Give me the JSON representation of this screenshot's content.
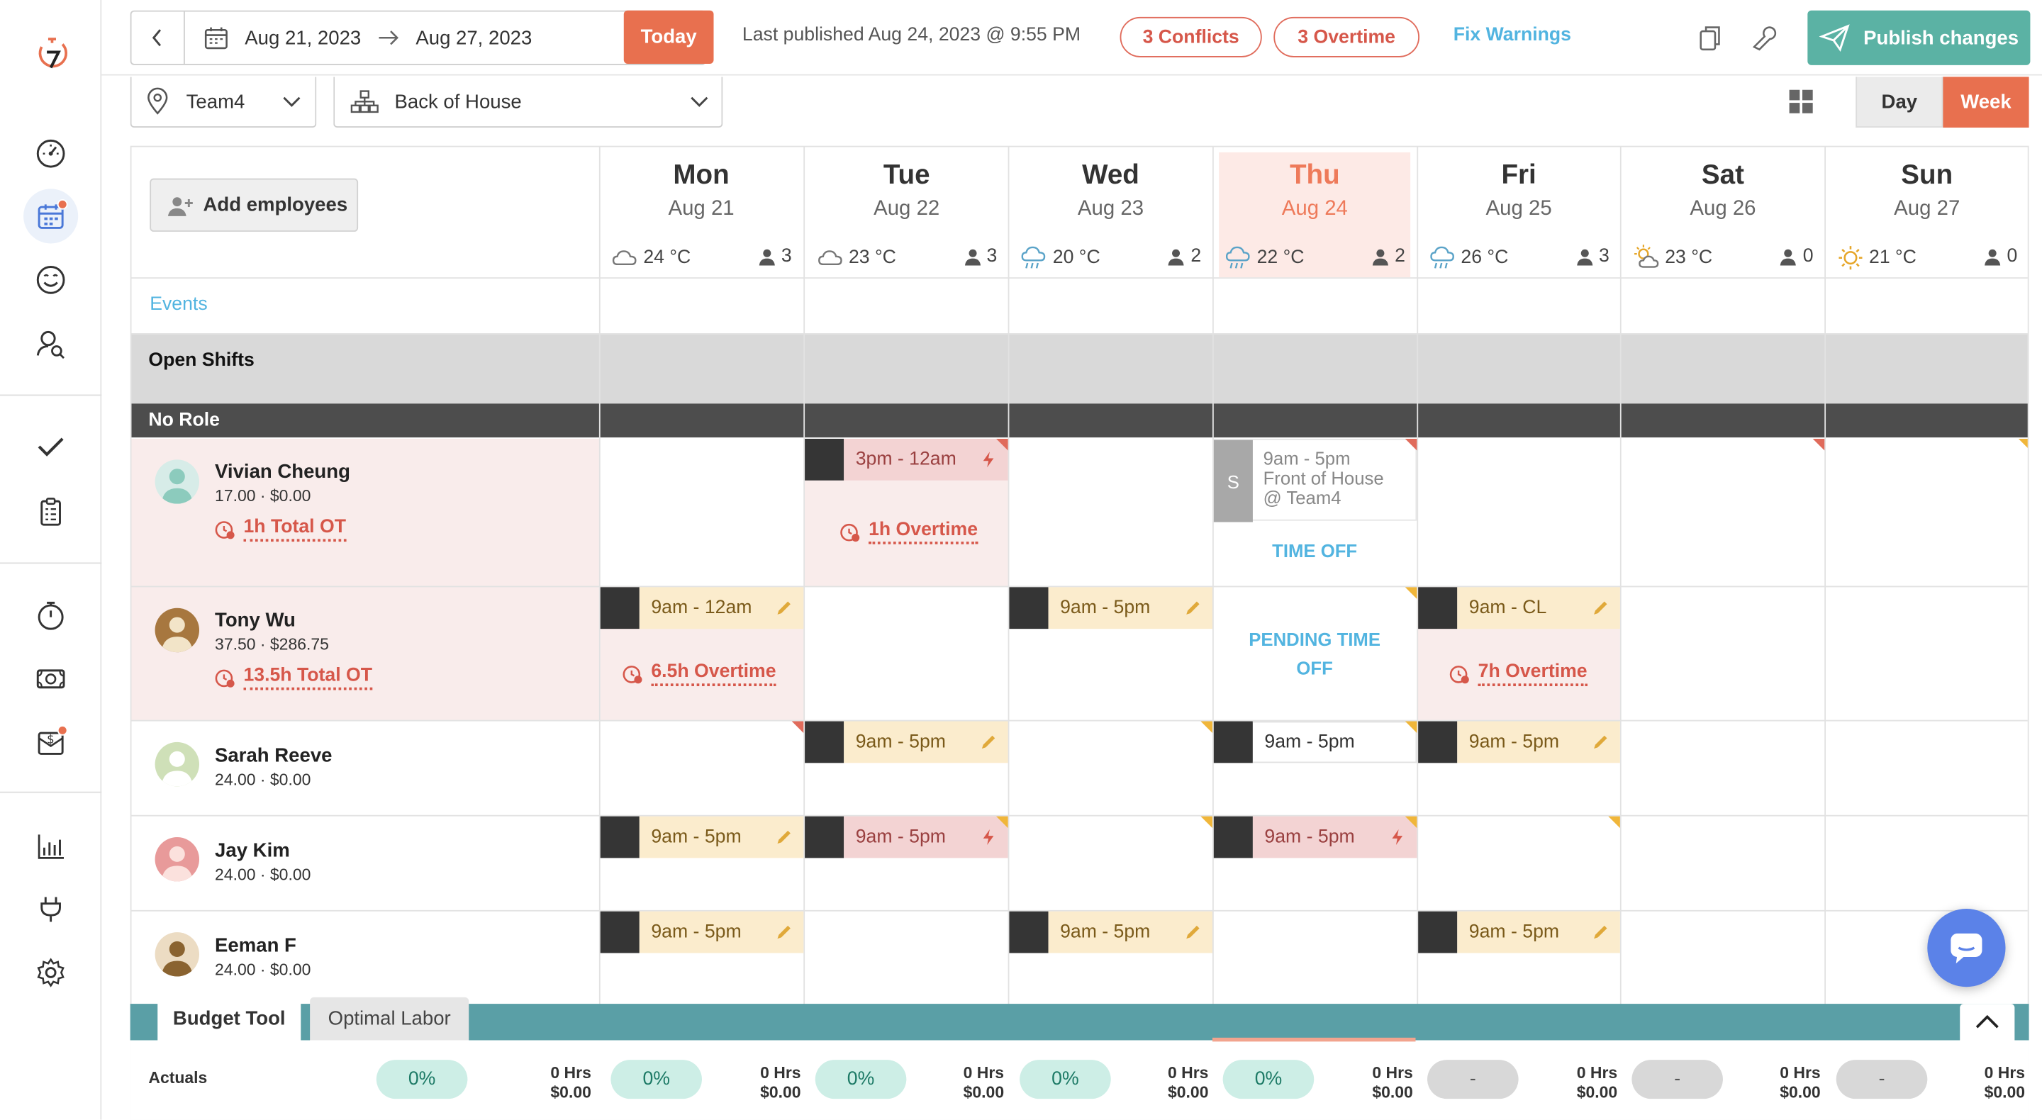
{
  "topbar": {
    "date_from": "Aug 21, 2023",
    "date_to": "Aug 27, 2023",
    "today_label": "Today",
    "published": "Last published Aug 24, 2023 @ 9:55 PM",
    "conflicts": "3 Conflicts",
    "overtime": "3 Overtime",
    "fix_warnings": "Fix Warnings",
    "publish": "Publish changes"
  },
  "filters": {
    "location": "Team4",
    "department": "Back of House",
    "view_day": "Day",
    "view_week": "Week",
    "active_view": "Week"
  },
  "grid": {
    "add_employees": "Add employees",
    "events_label": "Events",
    "open_shifts_label": "Open Shifts",
    "role_label": "No Role"
  },
  "days": [
    {
      "name": "Mon",
      "date": "Aug 21",
      "temp": "24 °C",
      "weather": "cloudy-icon",
      "count": "3",
      "today": false
    },
    {
      "name": "Tue",
      "date": "Aug 22",
      "temp": "23 °C",
      "weather": "cloudy-icon",
      "count": "3",
      "today": false
    },
    {
      "name": "Wed",
      "date": "Aug 23",
      "temp": "20 °C",
      "weather": "rain-icon",
      "count": "2",
      "today": false
    },
    {
      "name": "Thu",
      "date": "Aug 24",
      "temp": "22 °C",
      "weather": "rain-icon",
      "count": "2",
      "today": true
    },
    {
      "name": "Fri",
      "date": "Aug 25",
      "temp": "26 °C",
      "weather": "rain-icon",
      "count": "3",
      "today": false
    },
    {
      "name": "Sat",
      "date": "Aug 26",
      "temp": "23 °C",
      "weather": "partly-sunny-icon",
      "count": "0",
      "today": false
    },
    {
      "name": "Sun",
      "date": "Aug 27",
      "temp": "21 °C",
      "weather": "sunny-icon",
      "count": "0",
      "today": false
    }
  ],
  "employees": [
    {
      "name": "Vivian Cheung",
      "rate": "17.00 · $0.00",
      "total_ot": "1h Total OT"
    },
    {
      "name": "Tony Wu",
      "rate": "37.50 · $286.75",
      "total_ot": "13.5h Total OT"
    },
    {
      "name": "Sarah Reeve",
      "rate": "24.00 · $0.00",
      "total_ot": ""
    },
    {
      "name": "Jay Kim",
      "rate": "24.00 · $0.00",
      "total_ot": ""
    },
    {
      "name": "Eeman F",
      "rate": "24.00 · $0.00",
      "total_ot": ""
    }
  ],
  "shifts": {
    "vivian_tue": "3pm - 12am",
    "vivian_tue_ot": "1h Overtime",
    "vivian_thu_badge": "S",
    "vivian_thu_line1": "9am - 5pm",
    "vivian_thu_line2": "Front of House",
    "vivian_thu_line3": "@ Team4",
    "vivian_thu_timeoff": "TIME OFF",
    "tony_mon": "9am - 12am",
    "tony_mon_ot": "6.5h Overtime",
    "tony_wed": "9am - 5pm",
    "tony_thu_pending": "PENDING TIME OFF",
    "tony_fri": "9am - CL",
    "tony_fri_ot": "7h Overtime",
    "sarah_tue": "9am - 5pm",
    "sarah_thu": "9am - 5pm",
    "sarah_fri": "9am - 5pm",
    "jay_mon": "9am - 5pm",
    "jay_tue": "9am - 5pm",
    "jay_thu": "9am - 5pm",
    "eeman_mon": "9am - 5pm",
    "eeman_wed": "9am - 5pm",
    "eeman_fri": "9am - 5pm"
  },
  "budget": {
    "tab_budget": "Budget Tool",
    "tab_labor": "Optimal Labor",
    "actuals_label": "Actuals",
    "columns": [
      {
        "pct": "0%",
        "hrs": "0 Hrs",
        "cost": "$0.00",
        "state": "active"
      },
      {
        "pct": "0%",
        "hrs": "0 Hrs",
        "cost": "$0.00",
        "state": "active"
      },
      {
        "pct": "0%",
        "hrs": "0 Hrs",
        "cost": "$0.00",
        "state": "active"
      },
      {
        "pct": "0%",
        "hrs": "0 Hrs",
        "cost": "$0.00",
        "state": "active"
      },
      {
        "pct": "0%",
        "hrs": "0 Hrs",
        "cost": "$0.00",
        "state": "active"
      },
      {
        "pct": "-",
        "hrs": "0 Hrs",
        "cost": "$0.00",
        "state": "none"
      },
      {
        "pct": "-",
        "hrs": "0 Hrs",
        "cost": "$0.00",
        "state": "none"
      },
      {
        "pct": "-",
        "hrs": "0 Hrs",
        "cost": "$0.00",
        "state": "none"
      }
    ]
  },
  "colors": {
    "accent": "#e8704f",
    "publish": "#5bb2a4",
    "link": "#52b4e0",
    "warning": "#d6574a"
  }
}
